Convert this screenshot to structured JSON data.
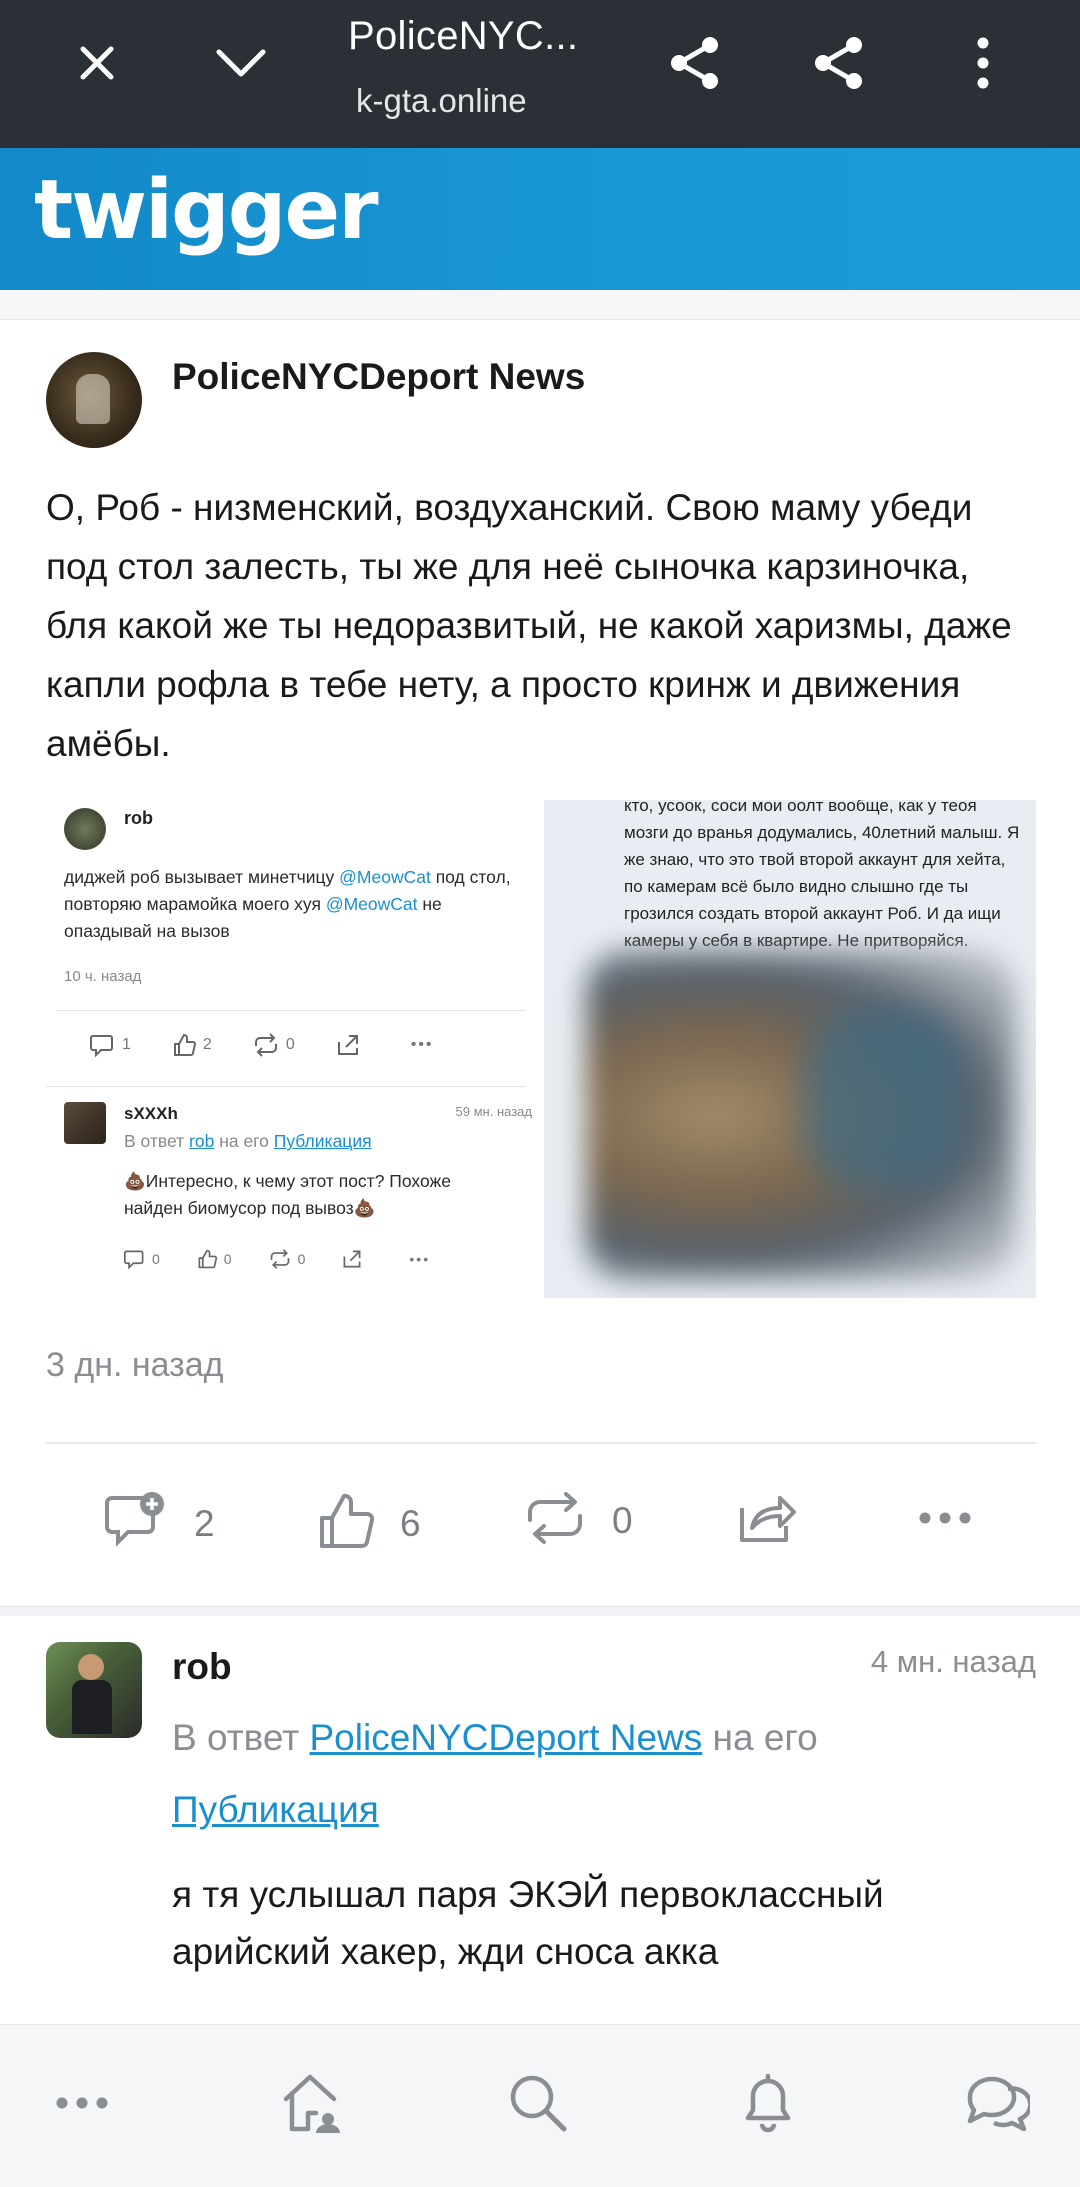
{
  "browser": {
    "title": "PoliceNYC...",
    "url": "k-gta.online"
  },
  "site": {
    "logo": "twigger"
  },
  "post": {
    "author": "PoliceNYCDeport News",
    "text": "О, Роб - низменский, воздуханский. Свою маму убеди под стол залесть, ты же для неё сыночка карзиночка, бля какой же ты недоразвитый, не какой харизмы, даже капли рофла в тебе нету, а просто кринж и движения амёбы.",
    "time": "3 дн. назад",
    "actions": {
      "comments": "2",
      "likes": "6",
      "reposts": "0"
    },
    "embed": {
      "post1": {
        "author": "rob",
        "text_before_1": "диджей роб вызывает минетчицу ",
        "mention_1": "@MeowCat",
        "text_mid": " под стол, повторяю марамойка моего хуя ",
        "mention_2": "@MeowCat",
        "text_after": " не опаздывай на вызов",
        "time": "10 ч. назад",
        "comments": "1",
        "likes": "2",
        "reposts": "0"
      },
      "post2": {
        "author": "sXXXh",
        "time": "59 мн. назад",
        "reply_prefix": "В ответ ",
        "reply_user": "rob",
        "reply_mid": " на его ",
        "reply_link": "Публикация",
        "text": "💩Интересно, к чему этот пост? Похоже найден биомусор под вывоз💩",
        "comments": "0",
        "likes": "0",
        "reposts": "0"
      },
      "right_text": "кто, усоок, соси мои оолт вообще, как у теоя мозги до вранья додумались, 40летний малыш. Я же знаю, что это твой второй аккаунт для хейта, по камерам всё было видно слышно где ты грозился создать второй аккаунт Роб. И да ищи камеры у себя в квартире. Не притворяйся."
    }
  },
  "reply": {
    "author": "rob",
    "time": "4 мн. назад",
    "prefix": "В ответ ",
    "target": "PoliceNYCDeport News",
    "mid": " на его",
    "link": "Публикация",
    "text": "я тя услышал паря ЭКЭЙ первоклассный арийский хакер, жди сноса акка"
  },
  "colors": {
    "browser_bar": "#2b2f36",
    "header_blue": "#1a98d6",
    "link": "#1a8fd0",
    "muted": "#8a8d91"
  }
}
